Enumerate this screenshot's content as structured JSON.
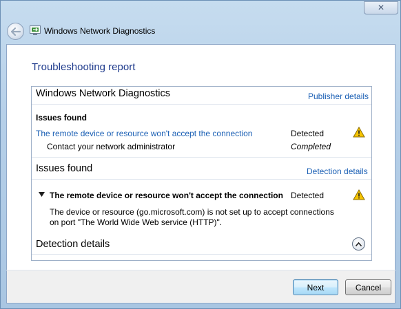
{
  "window": {
    "title": "Windows Network Diagnostics",
    "close_glyph": "✕"
  },
  "page": {
    "heading": "Troubleshooting report"
  },
  "report": {
    "section1": {
      "title": "Windows Network Diagnostics",
      "link": "Publisher details"
    },
    "issues_summary": {
      "label": "Issues found",
      "issue": {
        "text": "The remote device or resource won't accept the connection",
        "status": "Detected",
        "icon": "warning-icon"
      },
      "action": {
        "text": "Contact your network administrator",
        "status": "Completed"
      }
    },
    "section2": {
      "title": "Issues found",
      "link": "Detection details"
    },
    "issue_detail": {
      "title": "The remote device or resource won't accept the connection",
      "status": "Detected",
      "description_line1": "The device or resource (go.microsoft.com) is not set up to accept connections",
      "description_line2": "on port \"The World Wide Web service (HTTP)\"."
    },
    "section3": {
      "title": "Detection details"
    }
  },
  "buttons": {
    "next": "Next",
    "cancel": "Cancel"
  },
  "colors": {
    "link": "#1a5fb4",
    "heading": "#1e3a8c",
    "warning": "#f6c400"
  }
}
